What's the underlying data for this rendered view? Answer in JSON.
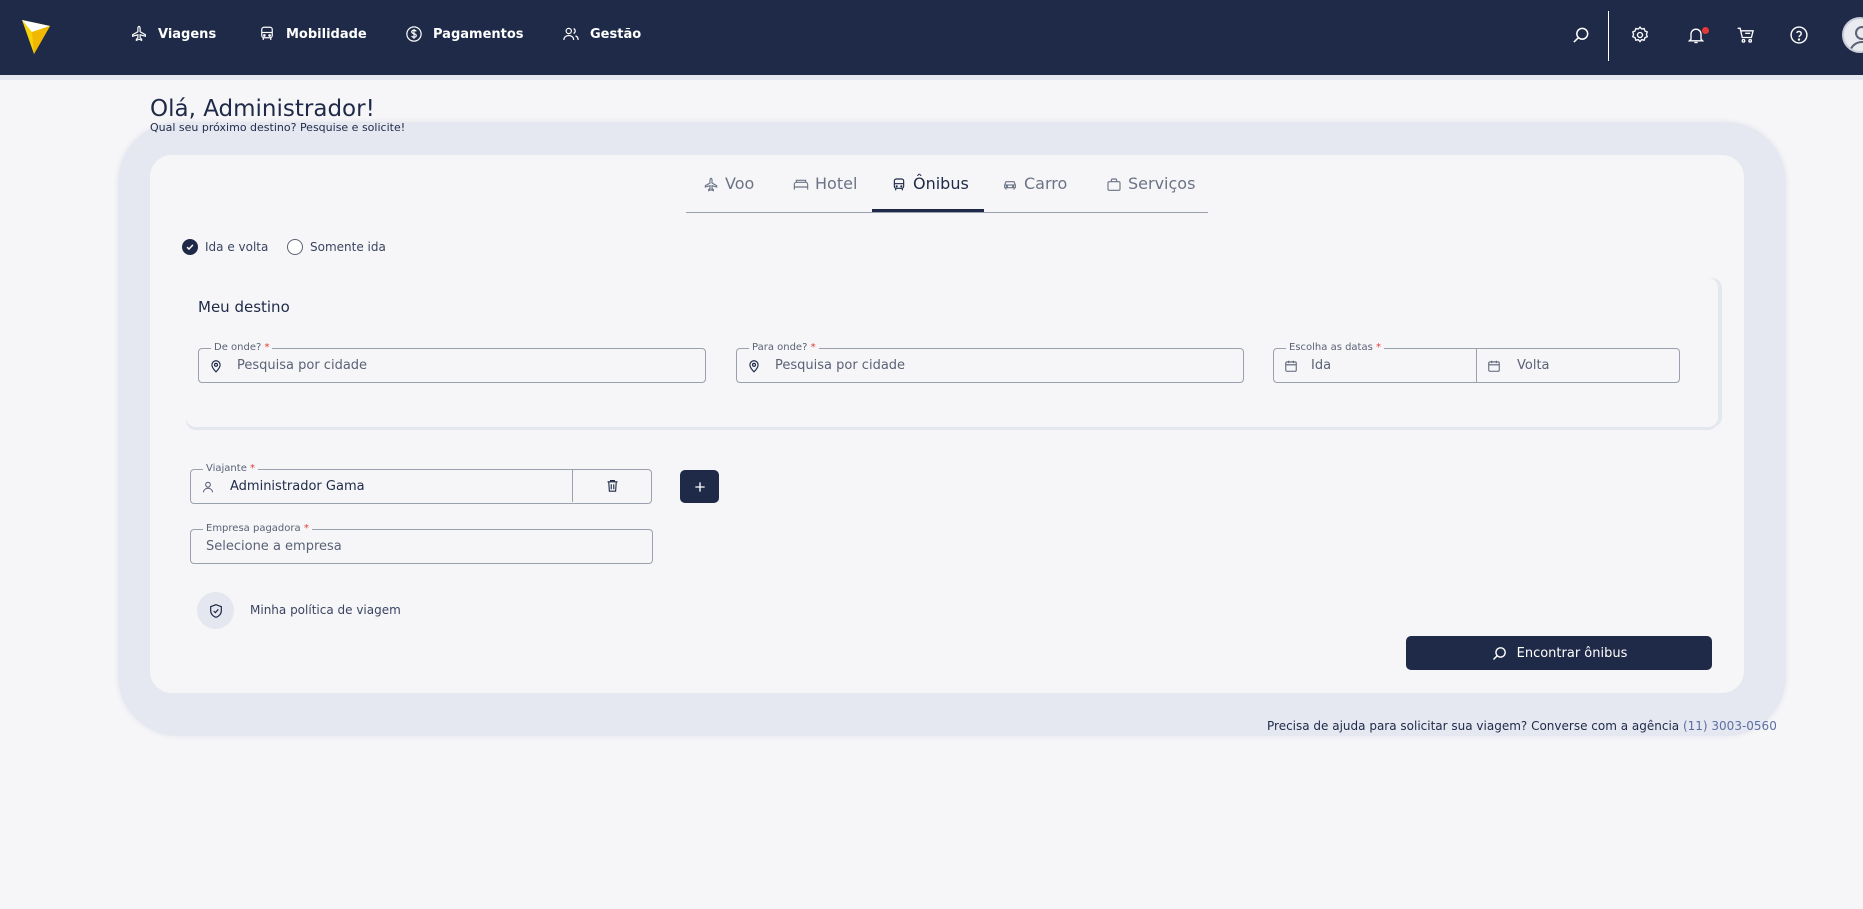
{
  "nav": {
    "items": [
      {
        "label": "Viagens",
        "icon": "plane-icon"
      },
      {
        "label": "Mobilidade",
        "icon": "car-icon"
      },
      {
        "label": "Pagamentos",
        "icon": "dollar-icon"
      },
      {
        "label": "Gestão",
        "icon": "users-icon"
      }
    ],
    "right_icons": [
      "search-icon",
      "gear-icon",
      "bell-icon",
      "cart-icon",
      "help-icon",
      "user-icon"
    ]
  },
  "greeting": {
    "title": "Olá, Administrador!",
    "subtitle": "Qual seu próximo destino? Pesquise e solicite!"
  },
  "tabs": [
    {
      "label": "Voo",
      "icon": "plane-icon"
    },
    {
      "label": "Hotel",
      "icon": "bed-icon"
    },
    {
      "label": "Ônibus",
      "icon": "bus-icon",
      "active": true
    },
    {
      "label": "Carro",
      "icon": "car-icon"
    },
    {
      "label": "Serviços",
      "icon": "bag-icon"
    }
  ],
  "trip_type": {
    "round_trip": "Ida e volta",
    "one_way": "Somente ida",
    "selected": "Ida e volta"
  },
  "destination": {
    "title": "Meu destino",
    "from": {
      "label": "De onde?",
      "placeholder": "Pesquisa por cidade"
    },
    "to": {
      "label": "Para onde?",
      "placeholder": "Pesquisa por cidade"
    },
    "dates": {
      "label": "Escolha as datas",
      "departure_placeholder": "Ida",
      "return_placeholder": "Volta"
    },
    "required_mark": "*"
  },
  "traveler": {
    "label": "Viajante",
    "value": "Administrador Gama"
  },
  "company": {
    "label": "Empresa pagadora",
    "placeholder": "Selecione a empresa"
  },
  "policy": {
    "label": "Minha política de viagem"
  },
  "search_button": {
    "label": "Encontrar ônibus"
  },
  "help": {
    "text": "Precisa de ajuda para solicitar sua viagem? Converse com a agência",
    "phone": "(11) 3003-0560"
  },
  "colors": {
    "navy": "#1e2a47",
    "background": "#f6f6f9",
    "accent_yellow": "#f5d20a",
    "notification": "#e53935"
  }
}
